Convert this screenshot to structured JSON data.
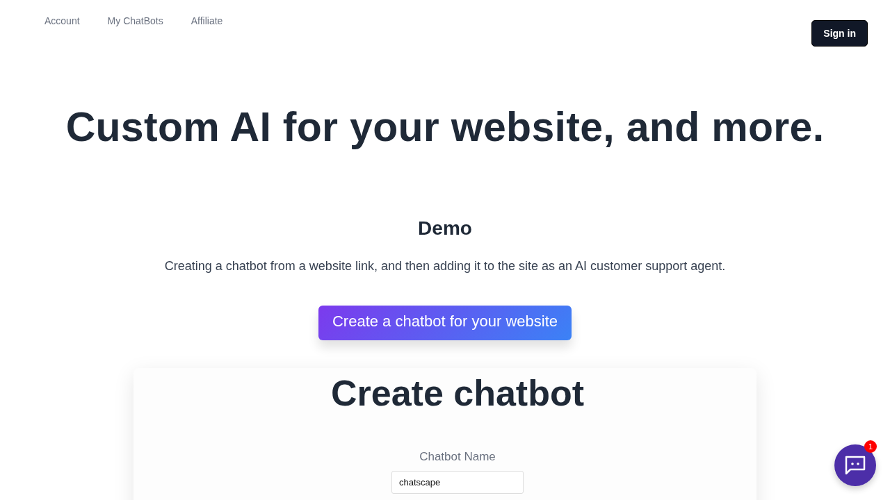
{
  "nav": {
    "links": [
      "Account",
      "My ChatBots",
      "Affiliate"
    ],
    "sign_in": "Sign in"
  },
  "hero": {
    "title": "Custom AI for your website, and more."
  },
  "demo": {
    "title": "Demo",
    "description": "Creating a chatbot from a website link, and then adding it to the site as an AI customer support agent.",
    "button": "Create a chatbot for your website"
  },
  "card": {
    "title": "Create chatbot",
    "field_label": "Chatbot Name",
    "field_value": "chatscape"
  },
  "chat_widget": {
    "badge": "1"
  }
}
